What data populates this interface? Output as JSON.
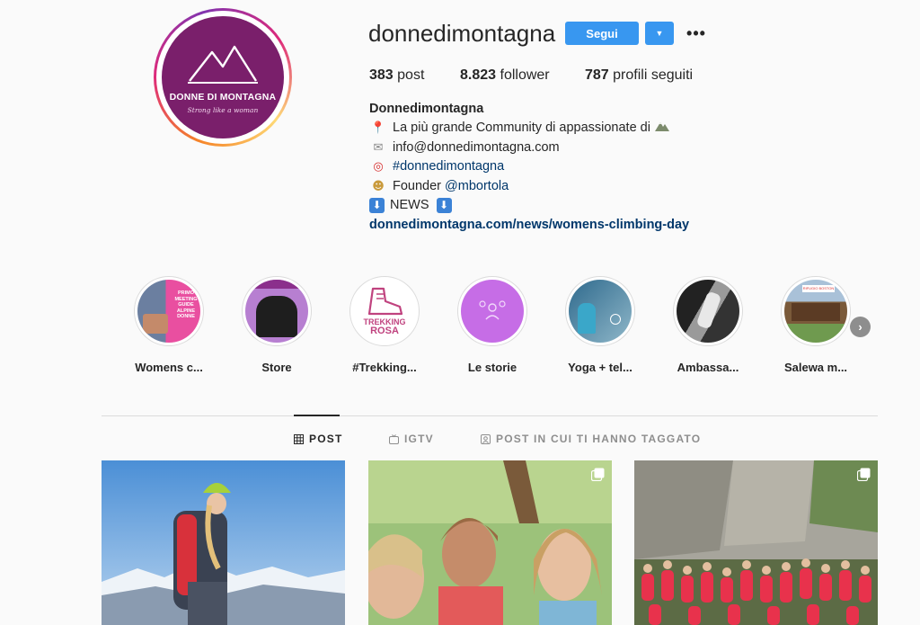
{
  "profile": {
    "username": "donnedimontagna",
    "follow_label": "Segui",
    "logo_text": "DONNE DI MONTAGNA",
    "logo_tagline": "Strong like a woman"
  },
  "stats": {
    "posts_count": "383",
    "posts_label": "post",
    "followers_count": "8.823",
    "followers_label": "follower",
    "following_count": "787",
    "following_label": "profili seguiti"
  },
  "bio": {
    "name": "Donnedimontagna",
    "line1": "La più grande Community di appassionate di",
    "line2": "info@donnedimontagna.com",
    "hashtag": "#donnedimontagna",
    "line4_prefix": "Founder",
    "mention": "@mbortola",
    "line5": "NEWS",
    "url": "donnedimontagna.com/news/womens-climbing-day"
  },
  "highlights": [
    {
      "label": "Womens c..."
    },
    {
      "label": "Store"
    },
    {
      "label": "#Trekking..."
    },
    {
      "label": "Le storie"
    },
    {
      "label": "Yoga + tel..."
    },
    {
      "label": "Ambassa..."
    },
    {
      "label": "Salewa m..."
    }
  ],
  "highlight_art": {
    "womens_text": "PRIMO MEETING GUIDE ALPINE DONNE",
    "trekking_text_1": "TREKKING",
    "trekking_text_2": "ROSA",
    "salewa_sign": "RIFUGIO BOSTON"
  },
  "tabs": {
    "posts": "POST",
    "igtv": "IGTV",
    "tagged": "POST IN CUI TI HANNO TAGGATO"
  },
  "colors": {
    "accent": "#3897f0",
    "brand_purple": "#7a1f6b",
    "link": "#00376b"
  }
}
